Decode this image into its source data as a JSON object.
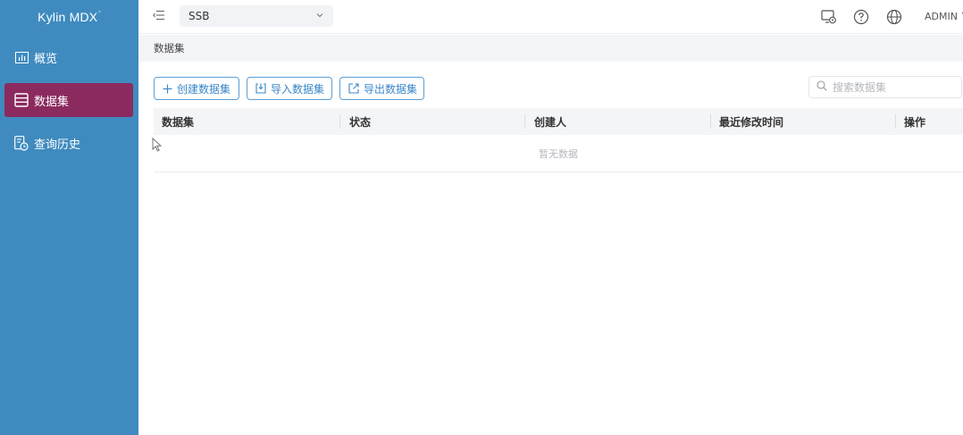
{
  "app": {
    "logo": "Kylin MDX",
    "logo_mark": "˜"
  },
  "sidebar": {
    "items": [
      {
        "label": "概览",
        "icon": "chart-icon",
        "active": false
      },
      {
        "label": "数据集",
        "icon": "dataset-icon",
        "active": true
      },
      {
        "label": "查询历史",
        "icon": "history-icon",
        "active": false
      }
    ]
  },
  "header": {
    "project": "SSB",
    "user": "ADMIN",
    "icons": [
      "menu-toggle-icon",
      "chevron-down-icon",
      "monitor-settings-icon",
      "help-icon",
      "globe-icon"
    ]
  },
  "breadcrumb": "数据集",
  "toolbar": {
    "create_label": "创建数据集",
    "import_label": "导入数据集",
    "export_label": "导出数据集",
    "search_placeholder": "搜索数据集"
  },
  "table": {
    "columns": [
      "数据集",
      "状态",
      "创建人",
      "最近修改时间",
      "操作"
    ],
    "empty_text": "暂无数据"
  },
  "colors": {
    "sidebar_bg": "#3f8bbf",
    "active_item": "#8b2a5e",
    "accent": "#3a87c8"
  }
}
